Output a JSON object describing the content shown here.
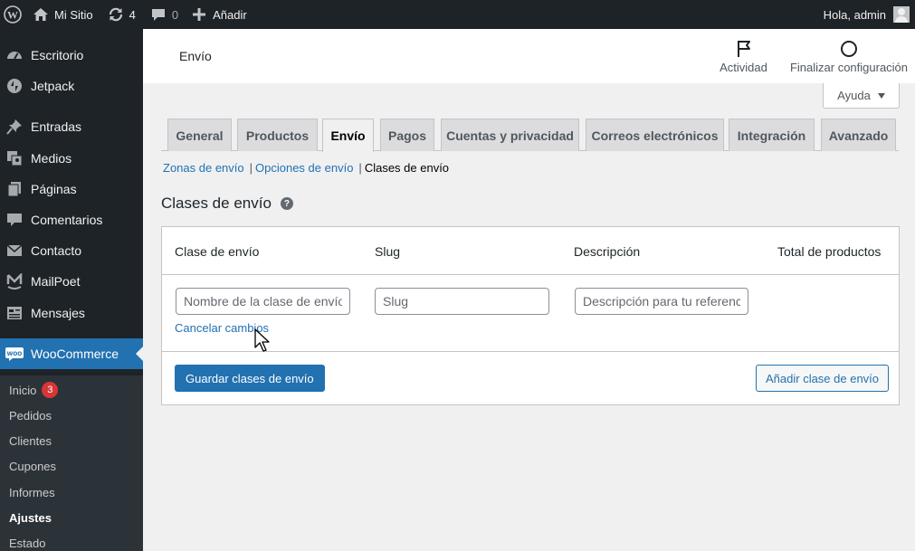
{
  "admin_bar": {
    "site_name": "Mi Sitio",
    "updates_count": "4",
    "comments_count": "0",
    "new_label": "Añadir",
    "greeting": "Hola, admin"
  },
  "sidebar": {
    "items": [
      {
        "label": "Escritorio",
        "icon": "dashboard-icon"
      },
      {
        "label": "Jetpack",
        "icon": "jetpack-icon"
      },
      {
        "label": "Entradas",
        "icon": "pin-icon"
      },
      {
        "label": "Medios",
        "icon": "media-icon"
      },
      {
        "label": "Páginas",
        "icon": "pages-icon"
      },
      {
        "label": "Comentarios",
        "icon": "comments-icon"
      },
      {
        "label": "Contacto",
        "icon": "mail-icon"
      },
      {
        "label": "MailPoet",
        "icon": "mailpoet-icon"
      },
      {
        "label": "Mensajes",
        "icon": "messages-icon"
      },
      {
        "label": "WooCommerce",
        "icon": "woo-icon"
      }
    ],
    "submenu": [
      {
        "label": "Inicio",
        "badge": "3"
      },
      {
        "label": "Pedidos"
      },
      {
        "label": "Clientes"
      },
      {
        "label": "Cupones"
      },
      {
        "label": "Informes"
      },
      {
        "label": "Ajustes"
      },
      {
        "label": "Estado"
      }
    ]
  },
  "header": {
    "title": "Envío",
    "activity_label": "Actividad",
    "finish_setup_label": "Finalizar configuración"
  },
  "help": {
    "label": "Ayuda"
  },
  "tabs": [
    {
      "label": "General"
    },
    {
      "label": "Productos"
    },
    {
      "label": "Envío",
      "active": true
    },
    {
      "label": "Pagos"
    },
    {
      "label": "Cuentas y privacidad"
    },
    {
      "label": "Correos electrónicos"
    },
    {
      "label": "Integración"
    },
    {
      "label": "Avanzado"
    }
  ],
  "subnav": {
    "zones": "Zonas de envío",
    "options": "Opciones de envío",
    "classes": "Clases de envío",
    "separator": "|"
  },
  "section": {
    "title": "Clases de envío",
    "help_glyph": "?"
  },
  "table": {
    "headers": [
      "Clase de envío",
      "Slug",
      "Descripción",
      "Total de productos"
    ],
    "placeholders": {
      "name": "Nombre de la clase de envío",
      "slug": "Slug",
      "description": "Descripción para tu referencia"
    },
    "cancel_label": "Cancelar cambios",
    "save_label": "Guardar clases de envío",
    "add_label": "Añadir clase de envío"
  },
  "colors": {
    "admin_bar": "#1d2327",
    "accent": "#2271b1",
    "badge": "#d63638"
  }
}
